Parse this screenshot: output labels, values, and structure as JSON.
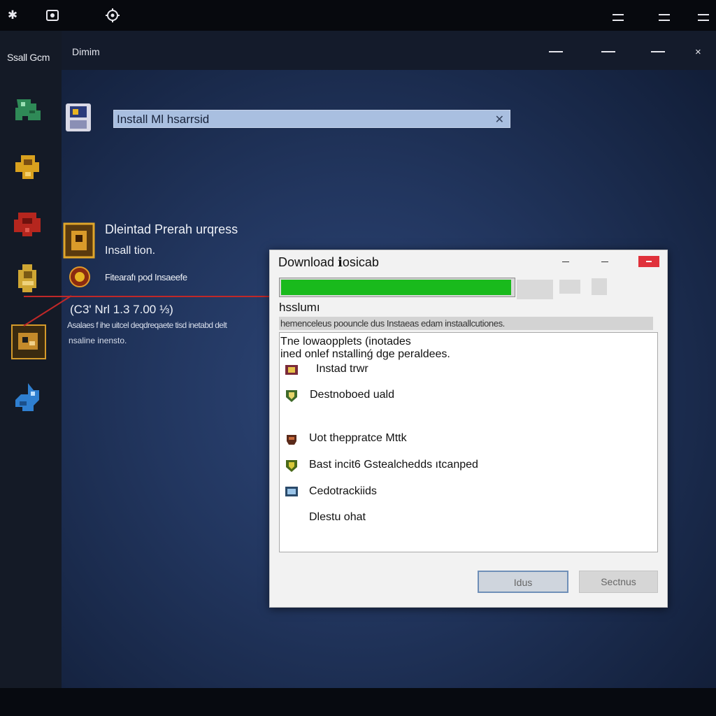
{
  "topbar": {
    "icons": [
      "puzzle-icon",
      "gamepad-icon",
      "settings-gear-icon"
    ],
    "menu_icons": [
      "menu-icon",
      "menu-icon",
      "menu-icon"
    ]
  },
  "sidebar": {
    "title": "Ssall Gcm",
    "games": [
      {
        "name": "green-creature-icon",
        "color": "#2f8a57"
      },
      {
        "name": "yellow-knight-icon",
        "color": "#d9a11e"
      },
      {
        "name": "red-warrior-icon",
        "color": "#b5261e"
      },
      {
        "name": "gold-figure-icon",
        "color": "#cfa633"
      },
      {
        "name": "selected-game-icon",
        "color": "#c48a2a"
      },
      {
        "name": "blue-creature-icon",
        "color": "#2f7fd0"
      }
    ]
  },
  "window": {
    "title": "Dimim",
    "close_glyph": "×"
  },
  "install_bar": {
    "text": "Install Ml hsarrsid",
    "close_glyph": "✕"
  },
  "game": {
    "title": "Dleintad Prerah urqress",
    "subtitle": "Insall tion.",
    "note": "Fitearafı pod Insaeefe",
    "price": "(C3' Nrl 1.3 7.00  ⅓)",
    "desc_line1": "Asalaes f ihe uitcel deqdreqaete tisd inetabd delt",
    "desc_line2": "nsaline inensto."
  },
  "dialog": {
    "title": "Download  ℹosicab",
    "progress": 0.99,
    "label": "hsslumı",
    "info_row": "hemenceleus poouncle dus  Instaeas edam instaallcutiones.",
    "desc_line1": "Tne lowaopplets (inotades",
    "desc_line2": "ined onlef nstallinǵ dge peraldees.",
    "items": [
      {
        "icon": "install-icon",
        "text": "Instad trwr"
      },
      {
        "icon": "shield-icon",
        "text": "Destnoboed uald"
      },
      {
        "icon": "helmet-icon",
        "text": "Uot theppratce Mttk"
      },
      {
        "icon": "shield-icon",
        "text": "Bast incit6 Gstealchedds ıtcanped"
      },
      {
        "icon": "monitor-icon",
        "text": "Cedotrackiids"
      },
      {
        "icon": "",
        "text": "Dlestu ohat"
      }
    ],
    "primary_button": "Idus",
    "secondary_button": "Sectnus",
    "colors": {
      "progress": "#19ba1c",
      "close": "#e0313b",
      "primary_border": "#6f8fb8"
    }
  }
}
